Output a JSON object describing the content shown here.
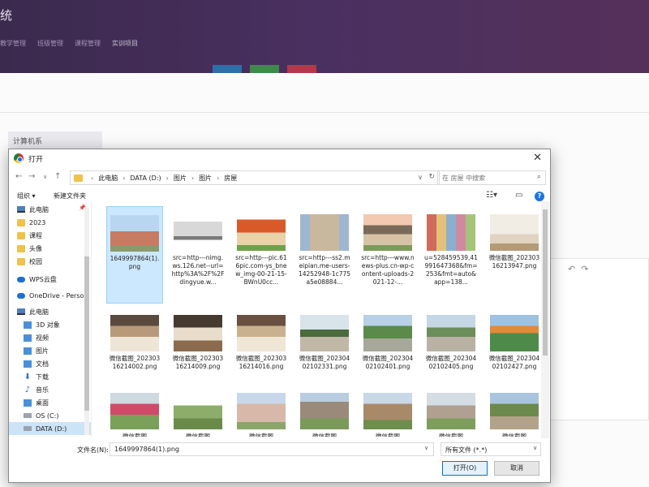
{
  "app": {
    "title": "统",
    "breadcrumbs": [
      "教学管理",
      "班级管理",
      "课程管理",
      "实训项目"
    ],
    "tag": "计算机系"
  },
  "dialog": {
    "title": "打开",
    "address": {
      "crumbs": [
        "此电脑",
        "DATA (D:)",
        "图片",
        "图片",
        "房屋"
      ],
      "search_placeholder": "在 房屋 中搜索"
    },
    "toolbar": {
      "organize": "组织 ▾",
      "new_folder": "新建文件夹"
    },
    "nav": [
      {
        "label": "此电脑",
        "icon": "pc-icon"
      },
      {
        "label": "2023",
        "icon": "folder-icon"
      },
      {
        "label": "课程",
        "icon": "folder-icon"
      },
      {
        "label": "头像",
        "icon": "folder-icon"
      },
      {
        "label": "校园",
        "icon": "folder-icon"
      },
      {
        "label": "WPS云盘",
        "icon": "cloud-icon"
      },
      {
        "label": "OneDrive - Perso",
        "icon": "cloud-icon"
      },
      {
        "label": "此电脑",
        "icon": "pc-icon"
      },
      {
        "label": "3D 对象",
        "icon": "blue-icon"
      },
      {
        "label": "视频",
        "icon": "blue-icon"
      },
      {
        "label": "图片",
        "icon": "blue-icon"
      },
      {
        "label": "文档",
        "icon": "blue-icon"
      },
      {
        "label": "下载",
        "icon": "download-icon"
      },
      {
        "label": "音乐",
        "icon": "music-icon"
      },
      {
        "label": "桌面",
        "icon": "blue-icon"
      },
      {
        "label": "OS (C:)",
        "icon": "drive-icon"
      },
      {
        "label": "DATA (D:)",
        "icon": "drive-icon"
      }
    ],
    "files": [
      {
        "name": "1649997864(1).png",
        "art": "t-red-bldg"
      },
      {
        "name": "src=http---nimg.ws.126.net--url=http%3A%2F%2Fdingyue.w...",
        "art": "t-villa"
      },
      {
        "name": "src=http---pic.616pic.com-ys_bnew_img-00-21-15-BWnU0cc...",
        "art": "t-cottage"
      },
      {
        "name": "src=http---ss2.meipian.me-users-14252948-1c775a5e08884...",
        "art": "t-tower"
      },
      {
        "name": "src=http---www.news-plus.cn-wp-content-uploads-2021-12-...",
        "art": "t-house"
      },
      {
        "name": "u=528459539,41991647368&fm=253&fmt=auto&app=138...",
        "art": "t-colorful"
      },
      {
        "name": "微信截图_20230316213947.png",
        "art": "t-room1"
      },
      {
        "name": "微信截图_20230316214002.png",
        "art": "t-room2"
      },
      {
        "name": "微信截图_20230316214009.png",
        "art": "t-room3"
      },
      {
        "name": "微信截图_20230316214016.png",
        "art": "t-room4"
      },
      {
        "name": "微信截图_20230402102331.png",
        "art": "t-park1"
      },
      {
        "name": "微信截图_20230402102401.png",
        "art": "t-park2"
      },
      {
        "name": "微信截图_20230402102405.png",
        "art": "t-park3"
      },
      {
        "name": "微信截图_20230402102427.png",
        "art": "t-park5"
      },
      {
        "name": "微信截图",
        "art": "t-flower"
      },
      {
        "name": "微信截图",
        "art": "t-field"
      },
      {
        "name": "微信截图",
        "art": "t-block1"
      },
      {
        "name": "微信截图",
        "art": "t-block2"
      },
      {
        "name": "微信截图",
        "art": "t-block3"
      },
      {
        "name": "微信截图",
        "art": "t-block4"
      },
      {
        "name": "微信截图",
        "art": "t-block5"
      }
    ],
    "filename_label": "文件名(N):",
    "filename_value": "1649997864(1).png",
    "filetype_value": "所有文件 (*.*)",
    "open_label": "打开(O)",
    "cancel_label": "取消"
  }
}
